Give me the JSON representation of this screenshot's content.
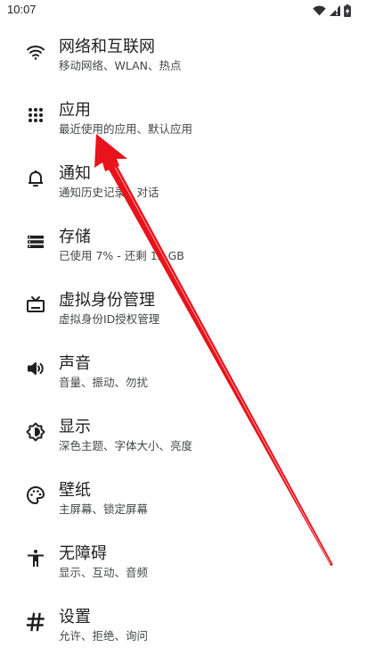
{
  "status_bar": {
    "time": "10:07",
    "icons": [
      "wifi-icon",
      "signal-icon",
      "battery-icon"
    ]
  },
  "settings": [
    {
      "title": "网络和互联网",
      "subtitle": "移动网络、WLAN、热点",
      "icon": "wifi-icon"
    },
    {
      "title": "应用",
      "subtitle": "最近使用的应用、默认应用",
      "icon": "apps-grid-icon"
    },
    {
      "title": "通知",
      "subtitle": "通知历史记录、对话",
      "icon": "bell-icon"
    },
    {
      "title": "存储",
      "subtitle": "已使用 7% - 还剩 12 GB",
      "icon": "storage-icon"
    },
    {
      "title": "虚拟身份管理",
      "subtitle": "虚拟身份ID授权管理",
      "icon": "tv-icon"
    },
    {
      "title": "声音",
      "subtitle": "音量、振动、勿扰",
      "icon": "speaker-icon"
    },
    {
      "title": "显示",
      "subtitle": "深色主题、字体大小、亮度",
      "icon": "brightness-icon"
    },
    {
      "title": "壁纸",
      "subtitle": "主屏幕、锁定屏幕",
      "icon": "palette-icon"
    },
    {
      "title": "无障碍",
      "subtitle": "显示、互动、音频",
      "icon": "accessibility-icon"
    },
    {
      "title": "设置",
      "subtitle": "允许、拒绝、询问",
      "icon": "hash-icon"
    }
  ],
  "annotation": {
    "type": "arrow",
    "color": "#e8131b",
    "points_to": "应用"
  }
}
